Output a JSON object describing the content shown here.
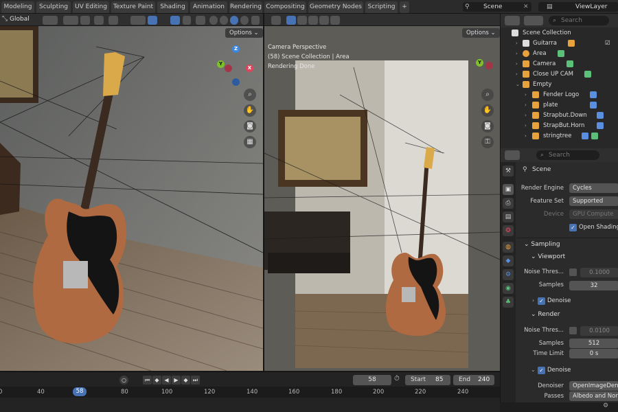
{
  "workspace_tabs": [
    {
      "label": "Modeling",
      "active": false
    },
    {
      "label": "Sculpting",
      "active": false
    },
    {
      "label": "UV Editing",
      "active": false
    },
    {
      "label": "Texture Paint",
      "active": false
    },
    {
      "label": "Shading",
      "active": false
    },
    {
      "label": "Animation",
      "active": false
    },
    {
      "label": "Rendering",
      "active": false
    },
    {
      "label": "Compositing",
      "active": false
    },
    {
      "label": "Geometry Nodes",
      "active": false
    },
    {
      "label": "Scripting",
      "active": false
    }
  ],
  "add_tab_label": "+",
  "scene_selector": {
    "value": "Scene"
  },
  "view_layer_selector": {
    "value": "ViewLayer"
  },
  "left_viewport": {
    "orientation": "Global",
    "options_label": "Options",
    "gizmo_axes": [
      "Z",
      "Y",
      "X"
    ]
  },
  "right_viewport": {
    "options_label": "Options",
    "overlay_lines": [
      "Camera Perspective",
      "(58) Scene Collection | Area",
      "Rendering Done"
    ],
    "gizmo_axes": [
      "Z",
      "Y",
      "X"
    ]
  },
  "outliner": {
    "search_placeholder": "Search",
    "items": [
      {
        "label": "Scene Collection",
        "icon": "collection-icon"
      },
      {
        "label": "Guitarra",
        "icon": "collection-icon"
      },
      {
        "label": "Area",
        "icon": "light-icon"
      },
      {
        "label": "Camera",
        "icon": "camera-icon"
      },
      {
        "label": "Close UP CAM",
        "icon": "camera-icon"
      },
      {
        "label": "Empty",
        "icon": "empty-icon"
      },
      {
        "label": "Fender Logo",
        "icon": "mesh-icon"
      },
      {
        "label": "plate",
        "icon": "mesh-icon"
      },
      {
        "label": "Strapbut.Down",
        "icon": "mesh-icon"
      },
      {
        "label": "StrapBut.Horn",
        "icon": "mesh-icon"
      },
      {
        "label": "stringtree",
        "icon": "mesh-icon"
      }
    ]
  },
  "properties": {
    "search_placeholder": "Search",
    "context_label": "Scene",
    "render_engine": {
      "label": "Render Engine",
      "value": "Cycles"
    },
    "feature_set": {
      "label": "Feature Set",
      "value": "Supported"
    },
    "device": {
      "label": "Device",
      "value": "GPU Compute"
    },
    "open_shading": {
      "label": "Open Shading L",
      "checked": true
    },
    "sampling": {
      "label": "Sampling"
    },
    "viewport": {
      "label": "Viewport",
      "noise_threshold": {
        "label": "Noise Thres...",
        "value": "0.1000"
      },
      "samples": {
        "label": "Samples",
        "value": "32"
      },
      "denoise": {
        "label": "Denoise",
        "checked": true
      }
    },
    "render": {
      "label": "Render",
      "noise_threshold": {
        "label": "Noise Thres...",
        "value": "0.0100"
      },
      "samples": {
        "label": "Samples",
        "value": "512"
      },
      "time_limit": {
        "label": "Time Limit",
        "value": "0 s"
      },
      "denoise": {
        "label": "Denoise",
        "checked": true
      },
      "denoiser": {
        "label": "Denoiser",
        "value": "OpenImageDen..."
      },
      "passes": {
        "label": "Passes",
        "value": "Albedo and Nor..."
      }
    }
  },
  "timeline": {
    "current_frame": "58",
    "start_label": "Start",
    "start_value": "85",
    "end_label": "End",
    "end_value": "240",
    "ruler": [
      "0",
      "40",
      "58",
      "80",
      "100",
      "120",
      "140",
      "160",
      "180",
      "200",
      "220",
      "240"
    ],
    "playhead": "58"
  },
  "colors": {
    "accent": "#4772b3",
    "axis_x": "#e0445a",
    "axis_y": "#7fc02a",
    "axis_z": "#3a86e0",
    "wall_left": "#7a7a78",
    "floor_left": "#7b6a5a",
    "guitar_body": "#b06a42"
  }
}
